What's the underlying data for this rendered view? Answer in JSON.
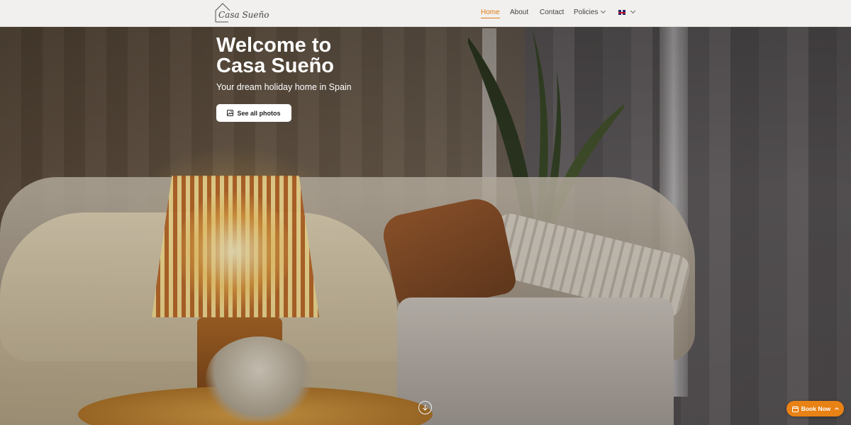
{
  "header": {
    "logo_text": "Casa Sueño",
    "nav": [
      {
        "label": "Home",
        "active": true
      },
      {
        "label": "About",
        "active": false
      },
      {
        "label": "Contact",
        "active": false
      },
      {
        "label": "Policies",
        "active": false,
        "has_dropdown": true
      }
    ],
    "language": {
      "icon": "uk-flag-icon",
      "has_dropdown": true
    }
  },
  "hero": {
    "title_line1": "Welcome to",
    "title_line2": "Casa Sueño",
    "subtitle": "Your dream holiday home in Spain",
    "photos_button": {
      "label": "See all photos",
      "icon": "image-icon"
    },
    "scroll_icon": "arrow-down-circle-icon"
  },
  "book_button": {
    "label": "Book Now",
    "icon": "calendar-icon"
  },
  "colors": {
    "accent": "#e98214",
    "header_bg": "#f1f0ee",
    "nav_active": "#e07a14",
    "hero_text": "#ffffff"
  }
}
